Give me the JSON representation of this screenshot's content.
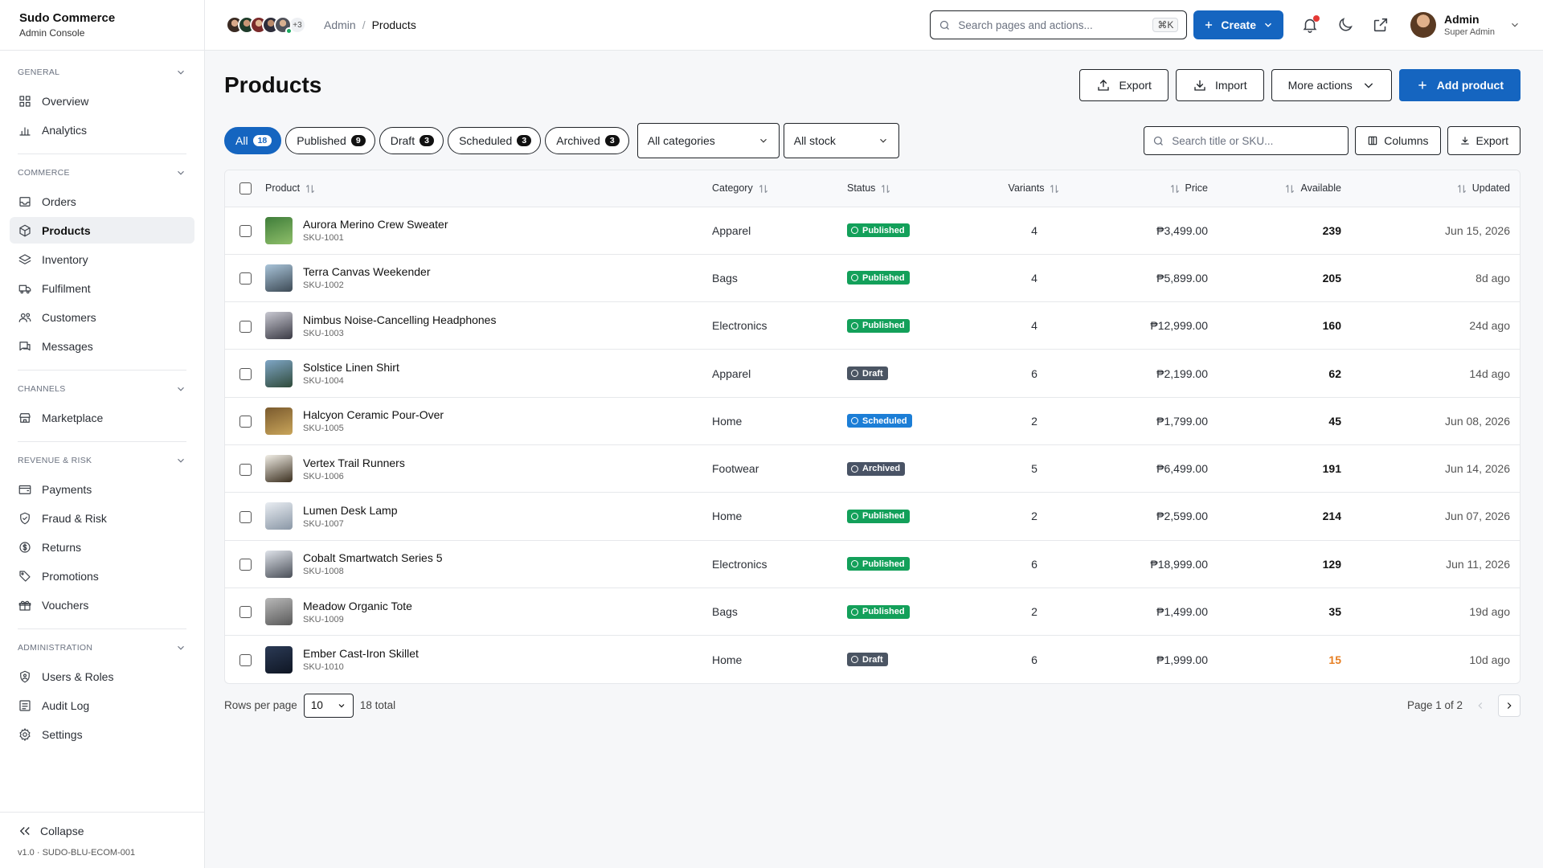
{
  "brand": {
    "name": "Sudo Commerce",
    "sub": "Admin Console"
  },
  "sidebar": {
    "sections": [
      {
        "title": "GENERAL",
        "items": [
          {
            "label": "Overview",
            "icon": "grid-icon"
          },
          {
            "label": "Analytics",
            "icon": "bar-chart-icon"
          }
        ]
      },
      {
        "title": "COMMERCE",
        "items": [
          {
            "label": "Orders",
            "icon": "inbox-icon"
          },
          {
            "label": "Products",
            "icon": "box-icon",
            "active": true
          },
          {
            "label": "Inventory",
            "icon": "layers-icon"
          },
          {
            "label": "Fulfilment",
            "icon": "truck-icon"
          },
          {
            "label": "Customers",
            "icon": "users-icon"
          },
          {
            "label": "Messages",
            "icon": "message-icon"
          }
        ]
      },
      {
        "title": "CHANNELS",
        "items": [
          {
            "label": "Marketplace",
            "icon": "store-icon"
          }
        ]
      },
      {
        "title": "REVENUE & RISK",
        "items": [
          {
            "label": "Payments",
            "icon": "wallet-icon"
          },
          {
            "label": "Fraud & Risk",
            "icon": "shield-icon"
          },
          {
            "label": "Returns",
            "icon": "dollar-circle-icon"
          },
          {
            "label": "Promotions",
            "icon": "tag-icon"
          },
          {
            "label": "Vouchers",
            "icon": "gift-icon"
          }
        ]
      },
      {
        "title": "ADMINISTRATION",
        "items": [
          {
            "label": "Users & Roles",
            "icon": "shield-user-icon"
          },
          {
            "label": "Audit Log",
            "icon": "list-icon"
          },
          {
            "label": "Settings",
            "icon": "gear-icon"
          }
        ]
      }
    ],
    "collapse_label": "Collapse",
    "version": "v1.0 · SUDO-BLU-ECOM-001"
  },
  "topbar": {
    "presence_more": "+3",
    "breadcrumb": {
      "root": "Admin",
      "sep": "/",
      "current": "Products"
    },
    "search_placeholder": "Search pages and actions...",
    "search_kbd": "⌘K",
    "create_label": "Create",
    "user": {
      "name": "Admin",
      "role": "Super Admin"
    }
  },
  "page": {
    "title": "Products",
    "actions": {
      "export": "Export",
      "import": "Import",
      "more": "More actions",
      "add": "Add product"
    }
  },
  "filters": {
    "chips": [
      {
        "label": "All",
        "count": "18",
        "active": true
      },
      {
        "label": "Published",
        "count": "9"
      },
      {
        "label": "Draft",
        "count": "3"
      },
      {
        "label": "Scheduled",
        "count": "3"
      },
      {
        "label": "Archived",
        "count": "3"
      }
    ],
    "category": "All categories",
    "stock": "All stock",
    "search_placeholder": "Search title or SKU...",
    "columns_label": "Columns",
    "export_label": "Export"
  },
  "table": {
    "headers": {
      "product": "Product",
      "category": "Category",
      "status": "Status",
      "variants": "Variants",
      "price": "Price",
      "available": "Available",
      "updated": "Updated"
    },
    "rows": [
      {
        "name": "Aurora Merino Crew Sweater",
        "sku": "SKU-1001",
        "category": "Apparel",
        "status": "Published",
        "variants": "4",
        "price": "₱3,499.00",
        "available": "239",
        "updated": "Jun 15, 2026",
        "thumb": [
          "#3f7d3a",
          "#8fbf6a"
        ]
      },
      {
        "name": "Terra Canvas Weekender",
        "sku": "SKU-1002",
        "category": "Bags",
        "status": "Published",
        "variants": "4",
        "price": "₱5,899.00",
        "available": "205",
        "updated": "8d ago",
        "thumb": [
          "#a9c4d9",
          "#3d4a55"
        ]
      },
      {
        "name": "Nimbus Noise-Cancelling Headphones",
        "sku": "SKU-1003",
        "category": "Electronics",
        "status": "Published",
        "variants": "4",
        "price": "₱12,999.00",
        "available": "160",
        "updated": "24d ago",
        "thumb": [
          "#c9c9d2",
          "#3a3a44"
        ]
      },
      {
        "name": "Solstice Linen Shirt",
        "sku": "SKU-1004",
        "category": "Apparel",
        "status": "Draft",
        "variants": "6",
        "price": "₱2,199.00",
        "available": "62",
        "updated": "14d ago",
        "thumb": [
          "#7fa6c6",
          "#2f4a3a"
        ]
      },
      {
        "name": "Halcyon Ceramic Pour-Over",
        "sku": "SKU-1005",
        "category": "Home",
        "status": "Scheduled",
        "variants": "2",
        "price": "₱1,799.00",
        "available": "45",
        "updated": "Jun 08, 2026",
        "thumb": [
          "#7a5a2e",
          "#c9a55a"
        ]
      },
      {
        "name": "Vertex Trail Runners",
        "sku": "SKU-1006",
        "category": "Footwear",
        "status": "Archived",
        "variants": "5",
        "price": "₱6,499.00",
        "available": "191",
        "updated": "Jun 14, 2026",
        "thumb": [
          "#f1eee6",
          "#3b2f1f"
        ]
      },
      {
        "name": "Lumen Desk Lamp",
        "sku": "SKU-1007",
        "category": "Home",
        "status": "Published",
        "variants": "2",
        "price": "₱2,599.00",
        "available": "214",
        "updated": "Jun 07, 2026",
        "thumb": [
          "#e9edf2",
          "#8a97a6"
        ]
      },
      {
        "name": "Cobalt Smartwatch Series 5",
        "sku": "SKU-1008",
        "category": "Electronics",
        "status": "Published",
        "variants": "6",
        "price": "₱18,999.00",
        "available": "129",
        "updated": "Jun 11, 2026",
        "thumb": [
          "#dfe3ea",
          "#4a4f58"
        ]
      },
      {
        "name": "Meadow Organic Tote",
        "sku": "SKU-1009",
        "category": "Bags",
        "status": "Published",
        "variants": "2",
        "price": "₱1,499.00",
        "available": "35",
        "updated": "19d ago",
        "thumb": [
          "#b8b8b8",
          "#5a5a5a"
        ]
      },
      {
        "name": "Ember Cast-Iron Skillet",
        "sku": "SKU-1010",
        "category": "Home",
        "status": "Draft",
        "variants": "6",
        "price": "₱1,999.00",
        "available": "15",
        "updated": "10d ago",
        "low": true,
        "thumb": [
          "#2b3a55",
          "#0f1624"
        ]
      }
    ]
  },
  "pager": {
    "rows_label": "Rows per page",
    "rows_value": "10",
    "total": "18 total",
    "page_label": "Page 1 of 2"
  },
  "colors": {
    "primary": "#1565c0",
    "published": "#13a05a",
    "draft": "#4b5563",
    "scheduled": "#1c7ed6",
    "archived": "#495365",
    "low_stock": "#e67e22"
  }
}
